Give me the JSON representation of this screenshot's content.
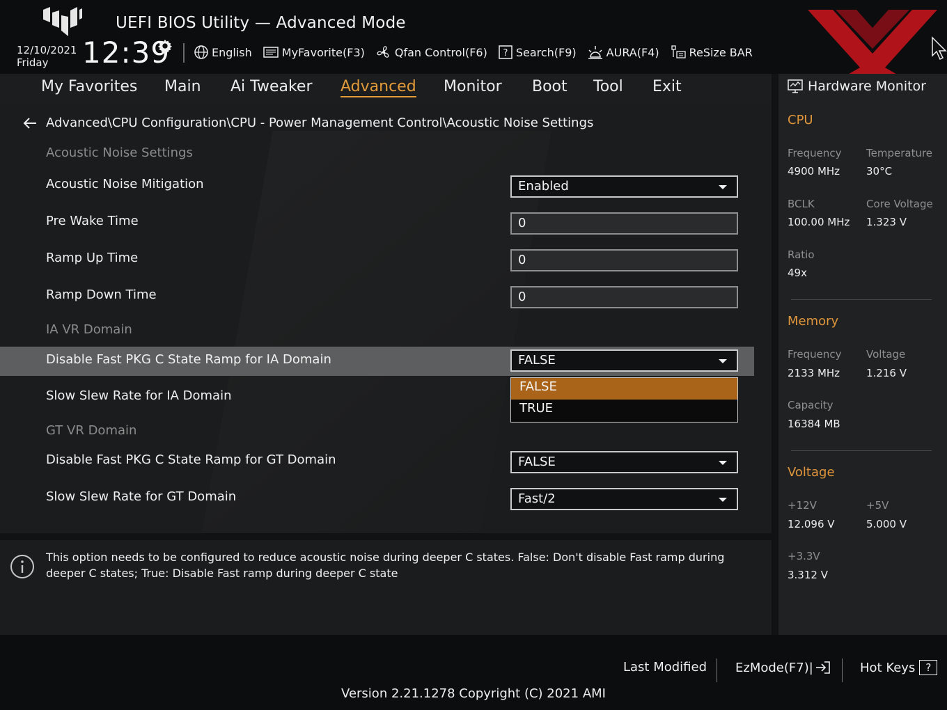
{
  "header": {
    "app_title": "UEFI BIOS Utility — Advanced Mode",
    "date": "12/10/2021",
    "day": "Friday",
    "time": "12:39",
    "tools": [
      {
        "label": "English",
        "icon": "globe-icon"
      },
      {
        "label": "MyFavorite(F3)",
        "icon": "favorite-icon"
      },
      {
        "label": "Qfan Control(F6)",
        "icon": "fan-icon"
      },
      {
        "label": "Search(F9)",
        "icon": "search-help-icon"
      },
      {
        "label": "AURA(F4)",
        "icon": "aura-icon"
      },
      {
        "label": "ReSize BAR",
        "icon": "resize-bar-icon"
      }
    ]
  },
  "tabs": [
    {
      "label": "My Favorites",
      "active": false
    },
    {
      "label": "Main",
      "active": false
    },
    {
      "label": "Ai Tweaker",
      "active": false
    },
    {
      "label": "Advanced",
      "active": true
    },
    {
      "label": "Monitor",
      "active": false
    },
    {
      "label": "Boot",
      "active": false
    },
    {
      "label": "Tool",
      "active": false
    },
    {
      "label": "Exit",
      "active": false
    }
  ],
  "breadcrumb": "Advanced\\CPU Configuration\\CPU - Power Management Control\\Acoustic Noise Settings",
  "sections": {
    "acoustic": "Acoustic Noise Settings",
    "ia_vr": "IA VR Domain",
    "gt_vr": "GT VR Domain"
  },
  "settings": [
    {
      "label": "Acoustic Noise Mitigation",
      "value": "Enabled",
      "type": "select"
    },
    {
      "label": "Pre Wake Time",
      "value": "0",
      "type": "number"
    },
    {
      "label": "Ramp Up Time",
      "value": "0",
      "type": "number"
    },
    {
      "label": "Ramp Down Time",
      "value": "0",
      "type": "number"
    },
    {
      "label": "Disable Fast PKG C State Ramp for IA Domain",
      "value": "FALSE",
      "type": "select"
    },
    {
      "label": "Slow Slew Rate for IA Domain",
      "value": "",
      "type": "select"
    },
    {
      "label": "Disable Fast PKG C State Ramp for GT Domain",
      "value": "FALSE",
      "type": "select"
    },
    {
      "label": "Slow Slew Rate for GT Domain",
      "value": "Fast/2",
      "type": "select"
    }
  ],
  "dropdown_options": [
    {
      "label": "FALSE",
      "selected": true
    },
    {
      "label": "TRUE",
      "selected": false
    }
  ],
  "help_text": "This option needs to be configured to reduce acoustic noise during deeper C states. False: Don't disable Fast ramp during deeper C states; True: Disable Fast ramp during deeper C state",
  "hardware_monitor": {
    "title": "Hardware Monitor",
    "cpu": {
      "section": "CPU",
      "frequency_label": "Frequency",
      "frequency": "4900 MHz",
      "temperature_label": "Temperature",
      "temperature": "30°C",
      "bclk_label": "BCLK",
      "bclk": "100.00 MHz",
      "core_voltage_label": "Core Voltage",
      "core_voltage": "1.323 V",
      "ratio_label": "Ratio",
      "ratio": "49x"
    },
    "memory": {
      "section": "Memory",
      "frequency_label": "Frequency",
      "frequency": "2133 MHz",
      "voltage_label": "Voltage",
      "voltage": "1.216 V",
      "capacity_label": "Capacity",
      "capacity": "16384 MB"
    },
    "voltage": {
      "section": "Voltage",
      "v12_label": "+12V",
      "v12": "12.096 V",
      "v5_label": "+5V",
      "v5": "5.000 V",
      "v33_label": "+3.3V",
      "v33": "3.312 V"
    }
  },
  "footer": {
    "last_modified": "Last Modified",
    "ezmode": "EzMode(F7)|",
    "hotkeys": "Hot Keys",
    "hotkeys_icon_text": "?",
    "version": "Version 2.21.1278 Copyright (C) 2021 AMI"
  },
  "colors": {
    "accent": "#e39b3a",
    "dropdown_selected": "#a9641a",
    "highlight_row": "#5d5e5f",
    "watermark": "#c8141e"
  }
}
